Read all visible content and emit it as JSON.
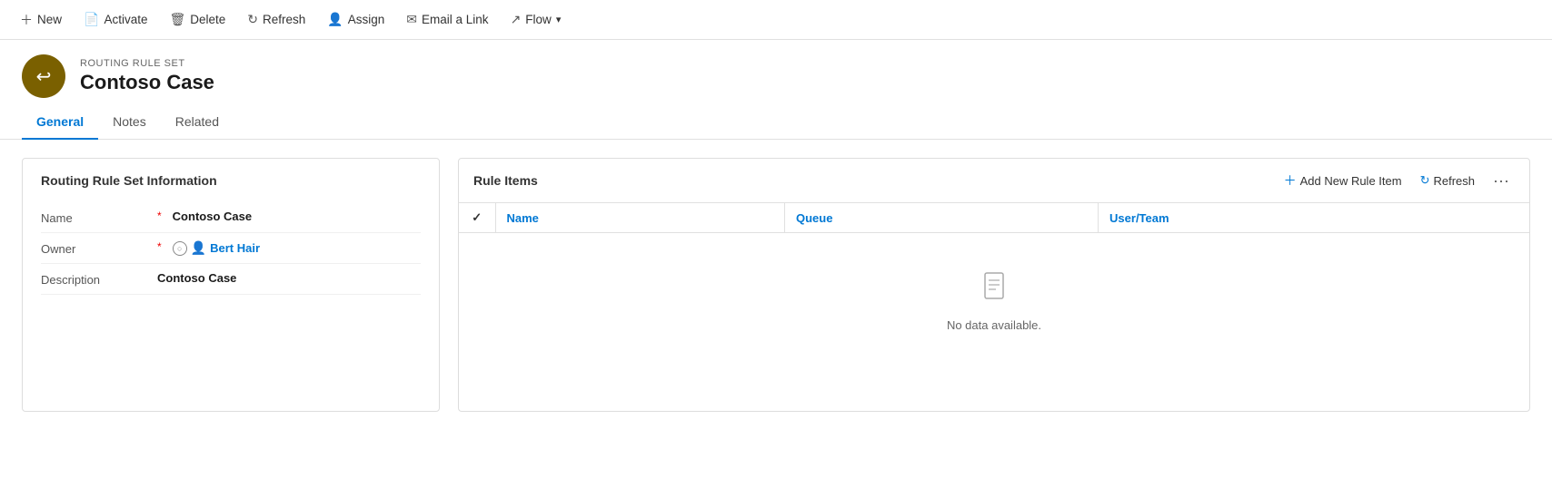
{
  "toolbar": {
    "new_label": "New",
    "activate_label": "Activate",
    "delete_label": "Delete",
    "refresh_label": "Refresh",
    "assign_label": "Assign",
    "email_link_label": "Email a Link",
    "flow_label": "Flow"
  },
  "record": {
    "subtitle": "ROUTING RULE SET",
    "title": "Contoso Case",
    "avatar_icon": "↩"
  },
  "tabs": [
    {
      "label": "General",
      "active": true
    },
    {
      "label": "Notes",
      "active": false
    },
    {
      "label": "Related",
      "active": false
    }
  ],
  "left_panel": {
    "title": "Routing Rule Set Information",
    "fields": [
      {
        "label": "Name",
        "value": "Contoso Case",
        "required": true,
        "type": "text"
      },
      {
        "label": "Owner",
        "value": "Bert Hair",
        "required": true,
        "type": "owner"
      },
      {
        "label": "Description",
        "value": "Contoso Case",
        "required": false,
        "type": "text"
      }
    ]
  },
  "right_panel": {
    "title": "Rule Items",
    "add_label": "Add New Rule Item",
    "refresh_label": "Refresh",
    "columns": [
      {
        "label": "✓",
        "type": "check"
      },
      {
        "label": "Name",
        "type": "link"
      },
      {
        "label": "Queue",
        "type": "link"
      },
      {
        "label": "User/Team",
        "type": "link"
      }
    ],
    "empty_text": "No data available."
  }
}
